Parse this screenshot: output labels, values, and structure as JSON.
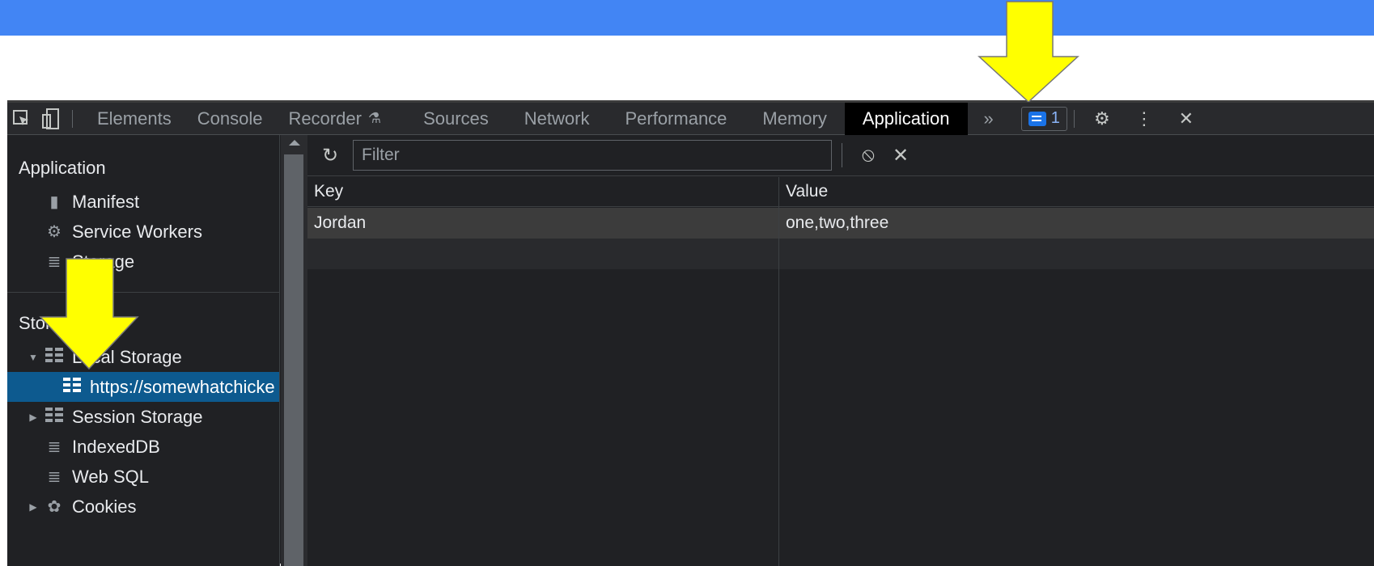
{
  "toolbar": {
    "tabs": [
      {
        "label": "Elements"
      },
      {
        "label": "Console"
      },
      {
        "label": "Recorder"
      },
      {
        "label": "Sources"
      },
      {
        "label": "Network"
      },
      {
        "label": "Performance"
      },
      {
        "label": "Memory"
      },
      {
        "label": "Application"
      }
    ],
    "active_tab": "Application",
    "more_tabs_glyph": "»",
    "issues_count": "1",
    "icons": [
      "inspect-element-icon",
      "device-toolbar-icon",
      "flask-icon",
      "chat-icon",
      "gear-icon",
      "kebab-menu-icon",
      "close-icon"
    ]
  },
  "sidebar": {
    "application_title": "Application",
    "application_items": [
      {
        "label": "Manifest",
        "icon": "document-icon"
      },
      {
        "label": "Service Workers",
        "icon": "gear-icon"
      },
      {
        "label": "Storage",
        "icon": "database-icon"
      }
    ],
    "storage_title": "Storage",
    "storage_items": [
      {
        "label": "Local Storage",
        "icon": "grid-icon",
        "expanded": true
      },
      {
        "label": "https://somewhatchicke",
        "icon": "grid-icon",
        "selected": true
      },
      {
        "label": "Session Storage",
        "icon": "grid-icon",
        "expanded": false
      },
      {
        "label": "IndexedDB",
        "icon": "database-icon"
      },
      {
        "label": "Web SQL",
        "icon": "database-icon"
      },
      {
        "label": "Cookies",
        "icon": "cookie-icon",
        "expanded": false
      }
    ]
  },
  "main": {
    "filter_placeholder": "Filter",
    "columns": [
      "Key",
      "Value"
    ],
    "rows": [
      {
        "key": "Jordan",
        "value": "one,two,three"
      }
    ]
  },
  "colors": {
    "top_bar": "#4285f4",
    "selected_row": "#0d5a8f",
    "annotation_arrow": "#ffff00"
  }
}
